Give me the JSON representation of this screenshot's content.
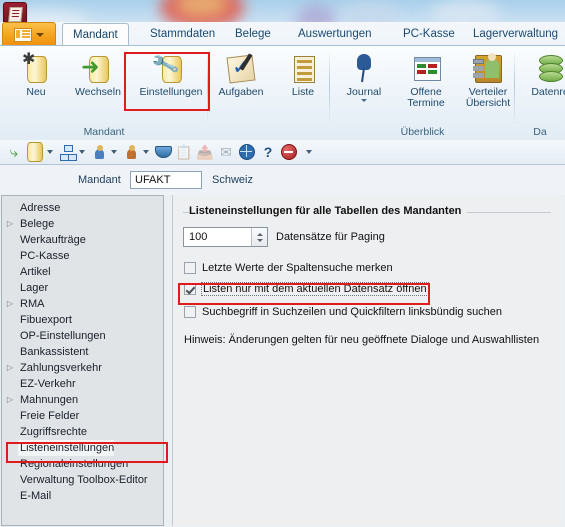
{
  "app": {
    "icon": "app-document-icon",
    "menu_button": "ribbon-menu-button"
  },
  "ribbon": {
    "tabs": [
      {
        "label": "Mandant",
        "active": true
      },
      {
        "label": "Stammdaten",
        "active": false
      },
      {
        "label": "Belege",
        "active": false
      },
      {
        "label": "Auswertungen",
        "active": false
      },
      {
        "label": "PC-Kasse",
        "active": false
      },
      {
        "label": "Lagerverwaltung",
        "active": false
      }
    ],
    "groups": [
      {
        "name": "Mandant",
        "buttons": [
          {
            "label": "Neu",
            "icon": "new-client-icon",
            "dropdown": false,
            "highlighted": false
          },
          {
            "label": "Wechseln",
            "icon": "switch-client-icon",
            "dropdown": false,
            "highlighted": false
          },
          {
            "label": "Einstellungen",
            "icon": "settings-wrench-icon",
            "dropdown": false,
            "highlighted": true
          }
        ]
      },
      {
        "name": "",
        "buttons": [
          {
            "label": "Aufgaben",
            "icon": "tasks-icon",
            "dropdown": false,
            "highlighted": false
          },
          {
            "label": "Liste",
            "icon": "list-icon",
            "dropdown": false,
            "highlighted": false
          }
        ]
      },
      {
        "name": "Überblick",
        "buttons": [
          {
            "label": "Journal",
            "icon": "journal-pin-icon",
            "dropdown": true,
            "highlighted": false
          },
          {
            "label": "Offene Termine",
            "icon": "open-appointments-icon",
            "dropdown": false,
            "highlighted": false
          },
          {
            "label": "Verteiler Übersicht",
            "icon": "distributor-overview-icon",
            "dropdown": false,
            "highlighted": false
          }
        ]
      },
      {
        "name": "Da",
        "buttons": [
          {
            "label": "Datenre",
            "icon": "database-icon",
            "dropdown": false,
            "highlighted": false
          }
        ]
      }
    ]
  },
  "toolbar": {
    "items": [
      {
        "name": "back-icon",
        "dropdown": false
      },
      {
        "name": "client-settings-icon",
        "dropdown": true
      },
      {
        "name": "hierarchy-icon",
        "dropdown": true
      },
      {
        "name": "user-blue-icon",
        "dropdown": true
      },
      {
        "name": "user-orange-icon",
        "dropdown": true
      },
      {
        "name": "inbox-icon",
        "dropdown": false
      },
      {
        "name": "copy-icon",
        "dropdown": false,
        "disabled": true
      },
      {
        "name": "export-icon",
        "dropdown": false,
        "disabled": true
      },
      {
        "name": "send-mail-icon",
        "dropdown": false,
        "disabled": true
      },
      {
        "name": "globe-icon",
        "dropdown": false
      },
      {
        "name": "help-icon",
        "dropdown": false
      },
      {
        "name": "stop-icon",
        "dropdown": false
      },
      {
        "name": "overflow-icon",
        "dropdown": false
      }
    ]
  },
  "mandant_bar": {
    "label": "Mandant",
    "value": "UFAKT",
    "placeholder": "",
    "country": "Schweiz"
  },
  "sidebar": {
    "items": [
      {
        "label": "Adresse",
        "expandable": false,
        "selected": false
      },
      {
        "label": "Belege",
        "expandable": true,
        "selected": false
      },
      {
        "label": "Werkaufträge",
        "expandable": false,
        "selected": false
      },
      {
        "label": "PC-Kasse",
        "expandable": false,
        "selected": false
      },
      {
        "label": "Artikel",
        "expandable": false,
        "selected": false
      },
      {
        "label": "Lager",
        "expandable": false,
        "selected": false
      },
      {
        "label": "RMA",
        "expandable": true,
        "selected": false
      },
      {
        "label": "Fibuexport",
        "expandable": false,
        "selected": false
      },
      {
        "label": "OP-Einstellungen",
        "expandable": false,
        "selected": false
      },
      {
        "label": "Bankassistent",
        "expandable": false,
        "selected": false
      },
      {
        "label": "Zahlungsverkehr",
        "expandable": true,
        "selected": false
      },
      {
        "label": "EZ-Verkehr",
        "expandable": false,
        "selected": false
      },
      {
        "label": "Mahnungen",
        "expandable": true,
        "selected": false
      },
      {
        "label": "Freie Felder",
        "expandable": false,
        "selected": false
      },
      {
        "label": "Zugriffsrechte",
        "expandable": false,
        "selected": false
      },
      {
        "label": "Listeneinstellungen",
        "expandable": false,
        "selected": true
      },
      {
        "label": "Regionaleinstellungen",
        "expandable": false,
        "selected": false
      },
      {
        "label": "Verwaltung Toolbox-Editor",
        "expandable": false,
        "selected": false
      },
      {
        "label": "E-Mail",
        "expandable": false,
        "selected": false
      }
    ]
  },
  "panel": {
    "group_title": "Listeneinstellungen für alle Tabellen des Mandanten",
    "paging": {
      "value": "100",
      "caption": "Datensätze für Paging"
    },
    "checkboxes": [
      {
        "label": "Letzte Werte der Spaltensuche merken",
        "checked": false,
        "highlighted": false
      },
      {
        "label": "Listen nur mit dem aktuellen Datensatz öffnen",
        "checked": true,
        "highlighted": true
      },
      {
        "label": "Suchbegriff in Suchzeilen und Quickfiltern linksbündig suchen",
        "checked": false,
        "highlighted": false
      }
    ],
    "hint": "Hinweis: Änderungen gelten für neu geöffnete Dialoge und Auswahllisten"
  },
  "annotations": {
    "color": "#e01b1b",
    "boxes": [
      {
        "name": "einstellungen-highlight"
      },
      {
        "name": "listeneinstellungen-highlight"
      },
      {
        "name": "checkbox-highlight"
      }
    ]
  }
}
